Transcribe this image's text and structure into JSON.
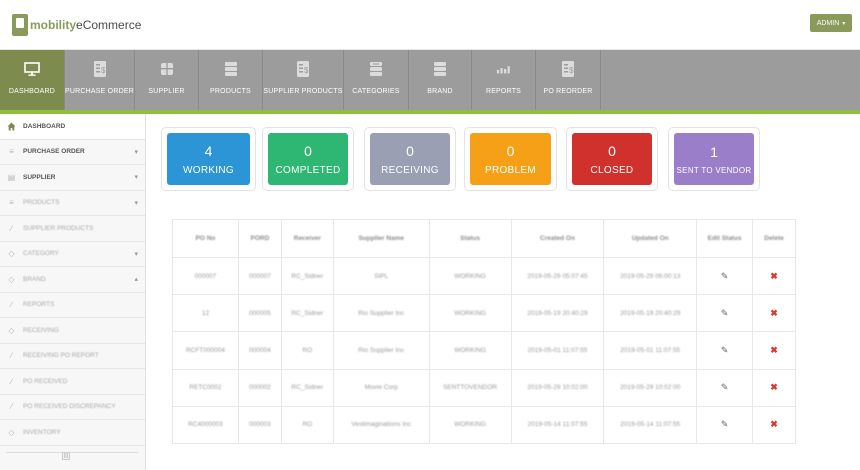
{
  "header": {
    "logo_brand": "mobility",
    "logo_rest": "eCommerce",
    "admin_label": "ADMIN",
    "admin_caret": "▾"
  },
  "nav": {
    "items": [
      {
        "label": "DASHBOARD",
        "icon": "monitor-icon",
        "active": true
      },
      {
        "label": "PURCHASE ORDER",
        "icon": "dollar-doc-icon",
        "active": false
      },
      {
        "label": "SUPPLIER",
        "icon": "supplier-icon",
        "active": false
      },
      {
        "label": "PRODUCTS",
        "icon": "stack-icon",
        "active": false
      },
      {
        "label": "SUPPLIER PRODUCTS",
        "icon": "dollar-doc-icon",
        "active": false
      },
      {
        "label": "CATEGORIES",
        "icon": "category-icon",
        "active": false
      },
      {
        "label": "BRAND",
        "icon": "stack-icon",
        "active": false
      },
      {
        "label": "REPORTS",
        "icon": "bar-chart-icon",
        "active": false
      },
      {
        "label": "PO REORDER",
        "icon": "dollar-doc-icon",
        "active": false
      }
    ]
  },
  "sidebar": {
    "items": [
      {
        "label": "DASHBOARD",
        "icon": "home-icon"
      },
      {
        "label": "PURCHASE ORDER",
        "icon": "list-icon",
        "caret": "▾"
      },
      {
        "label": "SUPPLIER",
        "icon": "doc-icon",
        "caret": "▾"
      },
      {
        "label": "PRODUCTS",
        "icon": "list-icon",
        "caret": "▾"
      },
      {
        "label": "SUPPLIER PRODUCTS",
        "icon": "link-icon"
      },
      {
        "label": "CATEGORY",
        "icon": "tag-icon",
        "caret": "▾"
      },
      {
        "label": "BRAND",
        "icon": "tag-icon",
        "caret": "▴"
      },
      {
        "label": "REPORTS",
        "icon": "link-icon"
      },
      {
        "label": "RECEIVING",
        "icon": "tag-icon"
      },
      {
        "label": "RECEIVING PO REPORT",
        "icon": "link-icon"
      },
      {
        "label": "PO RECEIVED",
        "icon": "link-icon"
      },
      {
        "label": "PO RECEIVED DISCREPANCY",
        "icon": "link-icon"
      },
      {
        "label": "INVENTORY",
        "icon": "tag-icon"
      }
    ],
    "scroll_thumb": "|||"
  },
  "status_cards": [
    {
      "count": "4",
      "label": "WORKING",
      "color": "#2b95d6"
    },
    {
      "count": "0",
      "label": "COMPLETED",
      "color": "#2eb673"
    },
    {
      "count": "0",
      "label": "RECEIVING",
      "color": "#9a9fb3"
    },
    {
      "count": "0",
      "label": "PROBLEM",
      "color": "#f5a016"
    },
    {
      "count": "0",
      "label": "CLOSED",
      "color": "#d0312d"
    },
    {
      "count": "1",
      "label": "SENT TO VENDOR",
      "color": "#9b7ec9"
    }
  ],
  "table": {
    "headers": [
      "PO No",
      "PORD",
      "Receiver",
      "Supplier Name",
      "Status",
      "Created On",
      "Updated On",
      "Edit Status",
      "Delete"
    ],
    "rows": [
      [
        "000007",
        "000007",
        "RC_Sidner",
        "SIPL",
        "WORKING",
        "2019-05-29 05:07:45",
        "2019-05-29 06:00:13"
      ],
      [
        "12",
        "000005",
        "RC_Sidner",
        "Rio Supplier Inc",
        "WORKING",
        "2019-05-19 20:40:29",
        "2019-05-19 20:40:29"
      ],
      [
        "RCFT000004",
        "000004",
        "RO",
        "Rio Supplier Inc",
        "WORKING",
        "2019-05-01 11:07:55",
        "2019-05-01 11:07:55"
      ],
      [
        "RETC0002",
        "000002",
        "RC_Sidner",
        "Movie Corp",
        "SENTTOVENDOR",
        "2019-05-29 10:02:00",
        "2019-05-29 10:02:00"
      ],
      [
        "RC4000003",
        "000003",
        "RO",
        "Vestimaginations Inc",
        "WORKING",
        "2019-05-14 11:07:55",
        "2019-05-14 11:07:55"
      ]
    ],
    "edit_glyph": "✎",
    "delete_glyph": "✖"
  }
}
